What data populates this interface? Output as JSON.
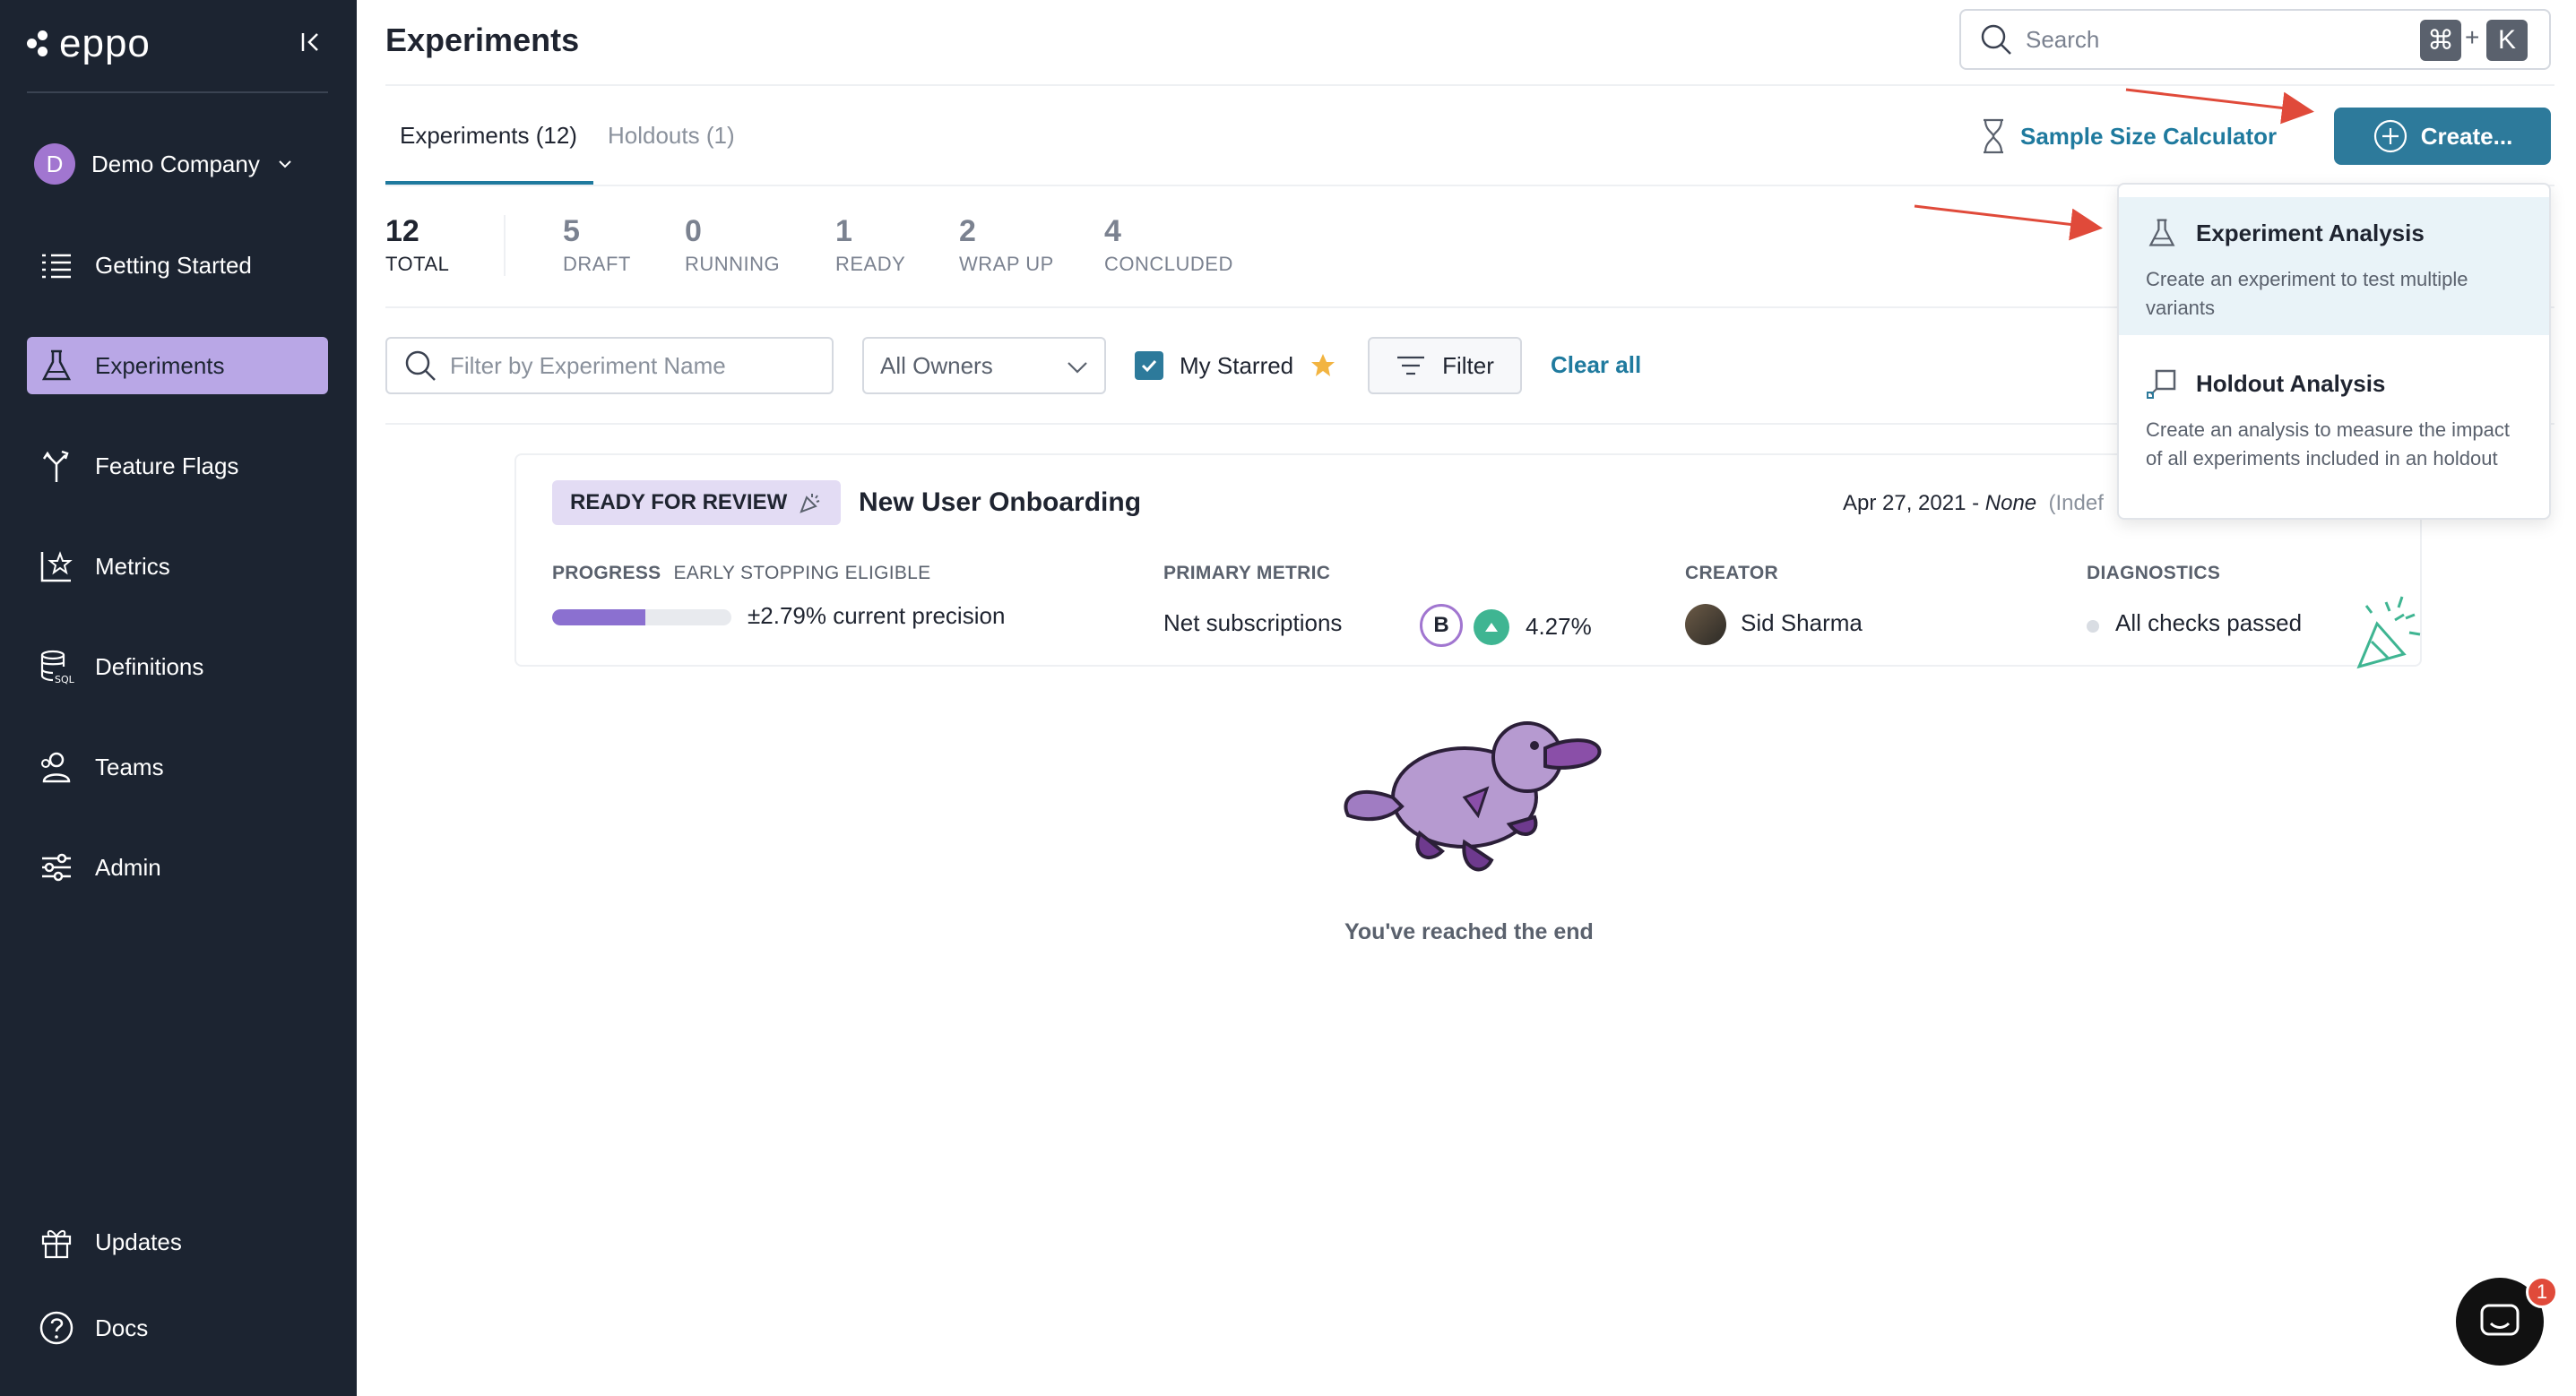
{
  "app": {
    "logo_text": "eppo"
  },
  "sidebar": {
    "company": {
      "initial": "D",
      "name": "Demo Company"
    },
    "items": [
      {
        "label": "Getting Started",
        "icon": "list-icon"
      },
      {
        "label": "Experiments",
        "icon": "flask-icon",
        "active": true
      },
      {
        "label": "Feature Flags",
        "icon": "flag-branch-icon"
      },
      {
        "label": "Metrics",
        "icon": "chart-star-icon"
      },
      {
        "label": "Definitions",
        "icon": "database-sql-icon"
      },
      {
        "label": "Teams",
        "icon": "users-icon"
      },
      {
        "label": "Admin",
        "icon": "sliders-icon"
      }
    ],
    "bottom_items": [
      {
        "label": "Updates",
        "icon": "gift-icon"
      },
      {
        "label": "Docs",
        "icon": "help-circle-icon"
      }
    ]
  },
  "header": {
    "title": "Experiments",
    "search": {
      "placeholder": "Search",
      "shortcut_mod": "⌘",
      "shortcut_plus": "+",
      "shortcut_key": "K"
    }
  },
  "tabs": [
    {
      "label": "Experiments (12)",
      "active": true
    },
    {
      "label": "Holdouts (1)",
      "active": false
    }
  ],
  "actions": {
    "sample_size_label": "Sample Size Calculator",
    "create_label": "Create..."
  },
  "stats": [
    {
      "value": "12",
      "label": "TOTAL"
    },
    {
      "value": "5",
      "label": "DRAFT"
    },
    {
      "value": "0",
      "label": "RUNNING"
    },
    {
      "value": "1",
      "label": "READY"
    },
    {
      "value": "2",
      "label": "WRAP UP"
    },
    {
      "value": "4",
      "label": "CONCLUDED"
    }
  ],
  "filters": {
    "name_placeholder": "Filter by Experiment Name",
    "owners_value": "All Owners",
    "starred_label": "My Starred",
    "starred_checked": true,
    "filter_label": "Filter",
    "clear_label": "Clear all"
  },
  "experiment": {
    "status": "READY FOR REVIEW",
    "name": "New User Onboarding",
    "date": "Apr 27, 2021 - ",
    "date_end": "None",
    "date_suffix": "(Indef",
    "progress_label": "PROGRESS",
    "progress_sublabel": "EARLY STOPPING ELIGIBLE",
    "progress_fraction": 0.52,
    "precision": "±2.79% current precision",
    "metric_label": "PRIMARY METRIC",
    "metric_name": "Net subscriptions",
    "metric_variant": "B",
    "metric_lift": "4.27%",
    "creator_label": "CREATOR",
    "creator_name": "Sid Sharma",
    "diagnostics_label": "DIAGNOSTICS",
    "diagnostics_text": "All checks passed"
  },
  "end_text": "You've reached the end",
  "create_menu": {
    "items": [
      {
        "title": "Experiment Analysis",
        "description": "Create an experiment to test multiple variants",
        "icon": "flask-icon"
      },
      {
        "title": "Holdout Analysis",
        "description": "Create an analysis to measure the impact of all experiments included in an holdout",
        "icon": "holdout-icon"
      }
    ]
  },
  "chat": {
    "badge_count": "1"
  },
  "colors": {
    "accent": "#2d7a9b",
    "sidebar_bg": "#1c2431",
    "active_nav": "#b9a7e6",
    "arrow": "#e04a3a"
  }
}
